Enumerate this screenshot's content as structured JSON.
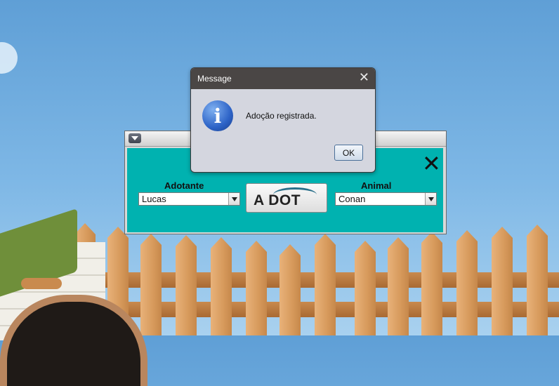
{
  "main_window": {
    "adotante": {
      "label": "Adotante",
      "selected": "Lucas"
    },
    "animal": {
      "label": "Animal",
      "selected": "Conan"
    },
    "logo_text": "A DOT",
    "close_icon": "close-icon"
  },
  "dialog": {
    "title": "Message",
    "message": "Adoção registrada.",
    "ok_label": "OK",
    "icon": "info-icon"
  },
  "colors": {
    "content_bg": "#00b2b0",
    "dialog_title_bg": "#4a4645",
    "sky": "#7fb8e6"
  }
}
